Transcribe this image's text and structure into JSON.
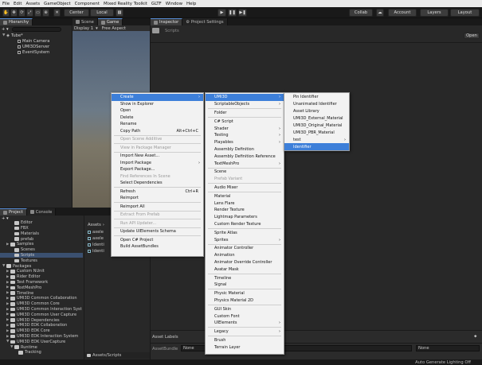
{
  "menubar": [
    "File",
    "Edit",
    "Assets",
    "GameObject",
    "Component",
    "Mixed Reality Toolkit",
    "GLTF",
    "Window",
    "Help"
  ],
  "toolbar": {
    "pivot": "Center",
    "space": "Local",
    "collab": "Collab",
    "account": "Account",
    "layers": "Layers",
    "layout": "Layout"
  },
  "hierarchy": {
    "tab": "Hierarchy",
    "scene_root": "Tube*",
    "items": [
      "Main Camera",
      "UMI3DServer",
      "EventSystem"
    ]
  },
  "scene": {
    "tabs": [
      "Scene",
      "Game"
    ],
    "display": "Display 1",
    "aspect": "Free Aspect"
  },
  "inspector": {
    "tabs": [
      "Inspector",
      "Project Settings"
    ],
    "title": "Scripts",
    "open_button": "Open"
  },
  "project": {
    "tabs": [
      "Project",
      "Console"
    ],
    "tree": [
      {
        "label": "Editor",
        "indent": 2,
        "arrow": ""
      },
      {
        "label": "FBX",
        "indent": 2,
        "arrow": ""
      },
      {
        "label": "Materials",
        "indent": 2,
        "arrow": ""
      },
      {
        "label": "prefab",
        "indent": 2,
        "arrow": ""
      },
      {
        "label": "Samples",
        "indent": 1,
        "arrow": "▶"
      },
      {
        "label": "Scenes",
        "indent": 2,
        "arrow": ""
      },
      {
        "label": "Scripts",
        "indent": 2,
        "arrow": "",
        "selected": true
      },
      {
        "label": "Textures",
        "indent": 2,
        "arrow": ""
      },
      {
        "label": "Packages",
        "indent": 0,
        "arrow": "▼"
      },
      {
        "label": "Custom NUnit",
        "indent": 1,
        "arrow": "▶"
      },
      {
        "label": "Rider Editor",
        "indent": 1,
        "arrow": "▶"
      },
      {
        "label": "Test Framework",
        "indent": 1,
        "arrow": "▶"
      },
      {
        "label": "TextMeshPro",
        "indent": 1,
        "arrow": "▶"
      },
      {
        "label": "Timeline",
        "indent": 1,
        "arrow": "▶"
      },
      {
        "label": "UMI3D Common Collaboration",
        "indent": 1,
        "arrow": "▶"
      },
      {
        "label": "UMI3D Common Core",
        "indent": 1,
        "arrow": "▶"
      },
      {
        "label": "UMI3D Common Interaction Syst",
        "indent": 1,
        "arrow": "▶"
      },
      {
        "label": "UMI3D Common User Capture",
        "indent": 1,
        "arrow": "▶"
      },
      {
        "label": "UMI3D Dependencies",
        "indent": 1,
        "arrow": "▶"
      },
      {
        "label": "UMI3D EDK Collaboration",
        "indent": 1,
        "arrow": "▶"
      },
      {
        "label": "UMI3D EDK Core",
        "indent": 1,
        "arrow": "▶"
      },
      {
        "label": "UMI3D EDK Interaction System",
        "indent": 1,
        "arrow": "▶"
      },
      {
        "label": "UMI3D EDK UserCapture",
        "indent": 1,
        "arrow": "▼"
      },
      {
        "label": "Runtime",
        "indent": 2,
        "arrow": "▼"
      },
      {
        "label": "Tracking",
        "indent": 3,
        "arrow": ""
      }
    ],
    "assets_breadcrumb": "Assets",
    "assets_scripts_breadcrumb": "Assets/Scripts",
    "files": [
      "axele",
      "axele",
      "Identi",
      "Identi"
    ]
  },
  "asset_labels": {
    "title": "Asset Labels",
    "bundle_label": "AssetBundle",
    "bundle_value": "None",
    "variant_value": "None"
  },
  "statusbar": "Auto Generate Lighting Off",
  "context_menu": {
    "items": [
      {
        "label": "Create",
        "sub": true,
        "hl": true
      },
      {
        "label": "Show in Explorer"
      },
      {
        "label": "Open"
      },
      {
        "label": "Delete"
      },
      {
        "label": "Rename"
      },
      {
        "label": "Copy Path",
        "shortcut": "Alt+Ctrl+C"
      },
      {
        "sep": true
      },
      {
        "label": "Open Scene Additive",
        "dis": true
      },
      {
        "sep": true
      },
      {
        "label": "View in Package Manager",
        "dis": true
      },
      {
        "sep": true
      },
      {
        "label": "Import New Asset..."
      },
      {
        "label": "Import Package",
        "sub": true
      },
      {
        "label": "Export Package..."
      },
      {
        "label": "Find References In Scene",
        "dis": true
      },
      {
        "label": "Select Dependencies"
      },
      {
        "sep": true
      },
      {
        "label": "Refresh",
        "shortcut": "Ctrl+R"
      },
      {
        "label": "Reimport"
      },
      {
        "sep": true
      },
      {
        "label": "Reimport All"
      },
      {
        "sep": true
      },
      {
        "label": "Extract From Prefab",
        "dis": true
      },
      {
        "sep": true
      },
      {
        "label": "Run API Updater...",
        "dis": true
      },
      {
        "sep": true
      },
      {
        "label": "Update UIElements Schema"
      },
      {
        "sep": true
      },
      {
        "label": "Open C# Project"
      },
      {
        "label": "Build AssetBundles"
      }
    ]
  },
  "create_menu": {
    "items": [
      {
        "label": "UMI3D",
        "sub": true,
        "hl": true
      },
      {
        "label": "ScriptableObjects",
        "sub": true
      },
      {
        "sep": true
      },
      {
        "label": "Folder"
      },
      {
        "sep": true
      },
      {
        "label": "C# Script"
      },
      {
        "label": "Shader",
        "sub": true
      },
      {
        "label": "Testing",
        "sub": true
      },
      {
        "label": "Playables",
        "sub": true
      },
      {
        "label": "Assembly Definition"
      },
      {
        "label": "Assembly Definition Reference"
      },
      {
        "label": "TextMeshPro",
        "sub": true
      },
      {
        "sep": true
      },
      {
        "label": "Scene"
      },
      {
        "label": "Prefab Variant",
        "dis": true
      },
      {
        "sep": true
      },
      {
        "label": "Audio Mixer"
      },
      {
        "sep": true
      },
      {
        "label": "Material"
      },
      {
        "label": "Lens Flare"
      },
      {
        "label": "Render Texture"
      },
      {
        "label": "Lightmap Parameters"
      },
      {
        "label": "Custom Render Texture"
      },
      {
        "sep": true
      },
      {
        "label": "Sprite Atlas"
      },
      {
        "label": "Sprites",
        "sub": true
      },
      {
        "sep": true
      },
      {
        "label": "Animator Controller"
      },
      {
        "label": "Animation"
      },
      {
        "label": "Animator Override Controller"
      },
      {
        "label": "Avatar Mask"
      },
      {
        "sep": true
      },
      {
        "label": "Timeline"
      },
      {
        "label": "Signal"
      },
      {
        "sep": true
      },
      {
        "label": "Physic Material"
      },
      {
        "label": "Physics Material 2D"
      },
      {
        "sep": true
      },
      {
        "label": "GUI Skin"
      },
      {
        "label": "Custom Font"
      },
      {
        "label": "UIElements",
        "sub": true
      },
      {
        "sep": true
      },
      {
        "label": "Legacy",
        "sub": true
      },
      {
        "sep": true
      },
      {
        "label": "Brush"
      },
      {
        "label": "Terrain Layer"
      }
    ]
  },
  "umi3d_menu": {
    "items": [
      {
        "label": "Pin Identifier"
      },
      {
        "label": "Unanimated Identifier"
      },
      {
        "label": "Asset Library"
      },
      {
        "label": "UMI3D_External_Material"
      },
      {
        "label": "UMI3D_Original_Material"
      },
      {
        "label": "UMI3D_PBR_Material"
      },
      {
        "label": "test",
        "sub": true
      },
      {
        "label": "Identifier",
        "hl": true
      }
    ]
  },
  "colors": {
    "highlight": "#3d7fd9",
    "menu_bg": "#f2f2f2",
    "editor_bg": "#282828"
  }
}
